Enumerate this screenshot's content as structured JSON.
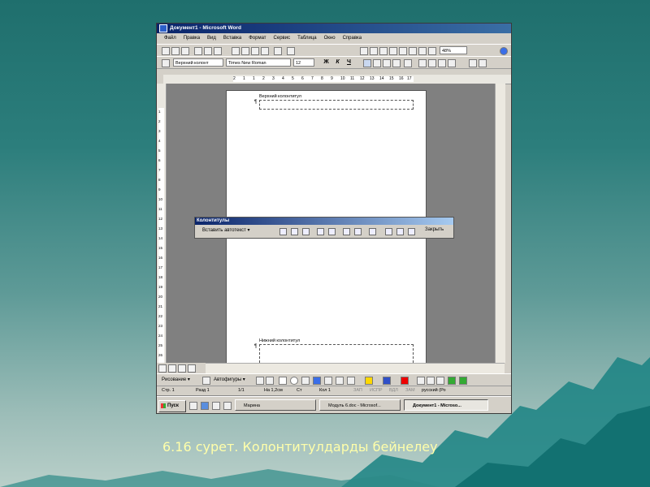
{
  "window": {
    "title": "Документ1 - Microsoft Word",
    "menu": [
      "Файл",
      "Правка",
      "Вид",
      "Вставка",
      "Формат",
      "Сервис",
      "Таблица",
      "Окно",
      "Справка"
    ],
    "zoom": "48%",
    "style": "Верхний колонт",
    "font": "Times New Roman",
    "font_size": "12",
    "bold": "Ж",
    "italic": "К",
    "underline": "Ч"
  },
  "ruler": [
    "2",
    "1",
    "1",
    "2",
    "3",
    "4",
    "5",
    "6",
    "7",
    "8",
    "9",
    "10",
    "11",
    "12",
    "13",
    "14",
    "15",
    "16",
    "17"
  ],
  "vruler": [
    "1",
    "2",
    "3",
    "4",
    "5",
    "6",
    "7",
    "8",
    "9",
    "10",
    "11",
    "12",
    "13",
    "14",
    "15",
    "16",
    "17",
    "18",
    "19",
    "20",
    "21",
    "22",
    "23",
    "24",
    "25",
    "26"
  ],
  "page": {
    "header_label": "Верхний колонтитул",
    "footer_label": "Нижний колонтитул",
    "para_mark": "¶"
  },
  "hf_toolbar": {
    "title": "Колонтитулы",
    "insert_auto": "Вставить автотекст ▾",
    "close": "Закрыть"
  },
  "drawing": {
    "draw": "Рисование ▾",
    "autoshapes": "Автофигуры ▾"
  },
  "status": {
    "page": "Стр. 1",
    "section": "Разд 1",
    "pages": "1/1",
    "at": "На 1,2см",
    "line": "Ст",
    "col": "Кол 1",
    "rec": "ЗАП",
    "trk": "ИСПР",
    "ext": "ВДЛ",
    "ovr": "ЗАМ",
    "lang": "русский (Ро"
  },
  "taskbar": {
    "start": "Пуск",
    "tasks": [
      "Марина",
      "Модуль 6.doc - Microsof...",
      "Документ1 - Microso..."
    ]
  },
  "caption": "6.16 сурет. Колонтитулдарды бейнелеу"
}
